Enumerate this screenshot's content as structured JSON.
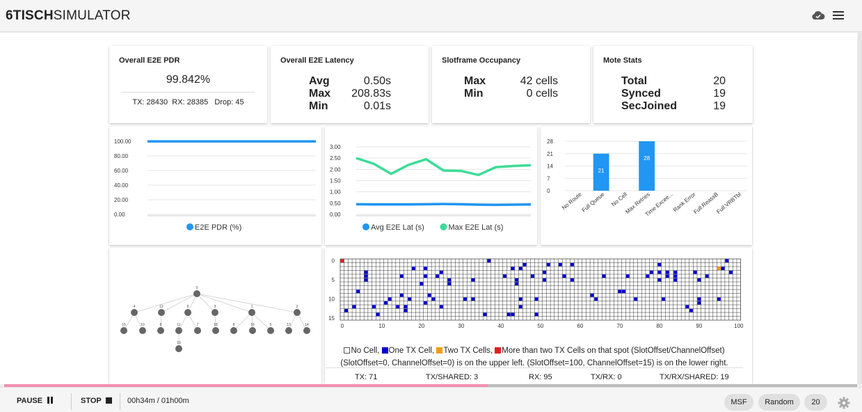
{
  "app": {
    "logo_bold": "6TISCH",
    "logo_rest": "SIMULATOR",
    "cloud_icon": "cloud-check-icon",
    "menu_icon": "hamburger-menu-icon"
  },
  "cards": {
    "pdr": {
      "title": "Overall E2E PDR",
      "value": "99.842%",
      "tx": "TX: 28430",
      "rx": "RX: 28385",
      "drop": "Drop: 45"
    },
    "latency": {
      "title": "Overall E2E Latency",
      "rows": [
        {
          "label": "Avg",
          "value": "0.50s"
        },
        {
          "label": "Max",
          "value": "208.83s"
        },
        {
          "label": "Min",
          "value": "0.01s"
        }
      ]
    },
    "occupancy": {
      "title": "Slotframe Occupancy",
      "rows": [
        {
          "label": "Max",
          "value": "42 cells"
        },
        {
          "label": "Min",
          "value": "0 cells"
        }
      ]
    },
    "motes": {
      "title": "Mote Stats",
      "rows": [
        {
          "label": "Total",
          "value": "20"
        },
        {
          "label": "Synced",
          "value": "19"
        },
        {
          "label": "SecJoined",
          "value": "19"
        }
      ]
    }
  },
  "chart_data": [
    {
      "type": "line",
      "x": [
        1,
        2,
        3,
        4,
        5,
        6,
        7,
        8,
        9,
        10
      ],
      "series": [
        {
          "name": "E2E PDR (%)",
          "color": "#2196f3",
          "values": [
            99.9,
            99.9,
            99.9,
            99.9,
            99.9,
            99.9,
            99.9,
            99.9,
            99.9,
            99.9
          ]
        }
      ],
      "yticks": [
        "100.00",
        "80.00",
        "60.00",
        "40.00",
        "20.00",
        "0.00"
      ],
      "ylim": [
        0,
        100
      ],
      "grid": true,
      "legend": "bottom"
    },
    {
      "type": "line",
      "x": [
        1,
        2,
        3,
        4,
        5,
        6,
        7,
        8,
        9,
        10,
        11
      ],
      "series": [
        {
          "name": "Avg E2E Lat (s)",
          "color": "#2196f3",
          "values": [
            0.45,
            0.44,
            0.44,
            0.44,
            0.45,
            0.46,
            0.45,
            0.43,
            0.42,
            0.43,
            0.44
          ]
        },
        {
          "name": "Max E2E Lat (s)",
          "color": "#3ddc97",
          "values": [
            2.5,
            2.25,
            1.8,
            2.2,
            2.45,
            1.95,
            1.93,
            1.75,
            2.1,
            2.15,
            2.18
          ]
        }
      ],
      "yticks": [
        "3.00",
        "2.50",
        "2.00",
        "1.50",
        "1.00",
        "0.50",
        "0.00"
      ],
      "ylim": [
        0,
        3
      ],
      "grid": true,
      "legend": "bottom"
    },
    {
      "type": "bar",
      "categories": [
        "No Route",
        "Full Queue",
        "No Cell",
        "Max Retries",
        "Time Excee...",
        "Rank Error",
        "Full.ReassB",
        "Full.VRBTbl"
      ],
      "values": [
        0,
        21,
        0,
        28,
        0,
        0,
        0,
        0
      ],
      "yticks": [
        "28",
        "21",
        "14",
        "7",
        "0"
      ],
      "ylim": [
        0,
        28
      ],
      "color": "#2196f3",
      "grid": true
    }
  ],
  "topology": {
    "root": "0",
    "level1": [
      "4",
      "12",
      "9",
      "3",
      "1",
      "2"
    ],
    "level2": [
      "15",
      "10",
      "6",
      "11",
      "7",
      "18",
      "8",
      "16",
      "5",
      "13",
      "14"
    ],
    "level3": [
      "19"
    ]
  },
  "schedule": {
    "yticks": [
      "0",
      "5",
      "10",
      "15"
    ],
    "xticks": [
      "0",
      "10",
      "20",
      "30",
      "40",
      "50",
      "60",
      "70",
      "80",
      "90",
      "100"
    ],
    "colors": {
      "one": "#0000cc",
      "two": "#f39c12",
      "more": "#e02020"
    },
    "legend_none": "No Cell, ",
    "legend_one": "One TX Cell, ",
    "legend_two": "Two TX Cells, ",
    "legend_more": "More than two TX Cells on that spot (SlotOffset/ChannelOffset)",
    "legend_line2": "(SlotOffset=0, ChannelOffset=0) is on the upper left. (SlotOffset=100, ChannelOffset=15) is on the lower right.",
    "stats": {
      "tx": "TX: 71",
      "txshared": "TX/SHARED: 3",
      "rx": "RX: 95",
      "txrx": "TX/RX: 0",
      "txrxshared": "TX/RX/SHARED: 19"
    }
  },
  "progress": {
    "fraction": 0.567
  },
  "controls": {
    "pause": "PAUSE",
    "stop": "STOP",
    "elapsed": "00h34m / 01h00m",
    "msf": "MSF",
    "random": "Random",
    "motes": "20",
    "gear_icon": "gear-icon"
  }
}
